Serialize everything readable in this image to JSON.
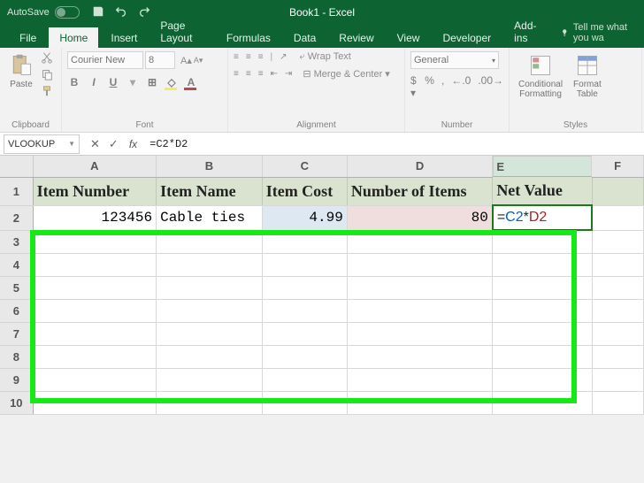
{
  "titlebar": {
    "autosave": "AutoSave",
    "title": "Book1  -  Excel"
  },
  "tabs": [
    "File",
    "Home",
    "Insert",
    "Page Layout",
    "Formulas",
    "Data",
    "Review",
    "View",
    "Developer",
    "Add-ins"
  ],
  "active_tab": "Home",
  "tell_me": "Tell me what you wa",
  "ribbon": {
    "clipboard": {
      "paste": "Paste",
      "label": "Clipboard"
    },
    "font": {
      "name": "Courier New",
      "size": "8",
      "label": "Font"
    },
    "alignment": {
      "wrap": "Wrap Text",
      "merge": "Merge & Center",
      "label": "Alignment"
    },
    "number": {
      "format": "General",
      "label": "Number"
    },
    "styles": {
      "cond": "Conditional\nFormatting",
      "tbl": "Format\nTable",
      "label": "Styles"
    }
  },
  "formula_bar": {
    "name_box": "VLOOKUP",
    "formula": "=C2*D2"
  },
  "columns": [
    "A",
    "B",
    "C",
    "D",
    "E",
    "F"
  ],
  "rows": [
    "1",
    "2",
    "3",
    "4",
    "5",
    "6",
    "7",
    "8",
    "9",
    "10"
  ],
  "headers": [
    "Item Number",
    "Item Name",
    "Item Cost",
    "Number of Items",
    "Net Value"
  ],
  "data_row": {
    "item_number": "123456",
    "item_name": "Cable ties",
    "item_cost": "4.99",
    "num_items": "80",
    "formula_parts": {
      "eq": "=",
      "c2": "C2",
      "op": "*",
      "d2": "D2"
    }
  }
}
